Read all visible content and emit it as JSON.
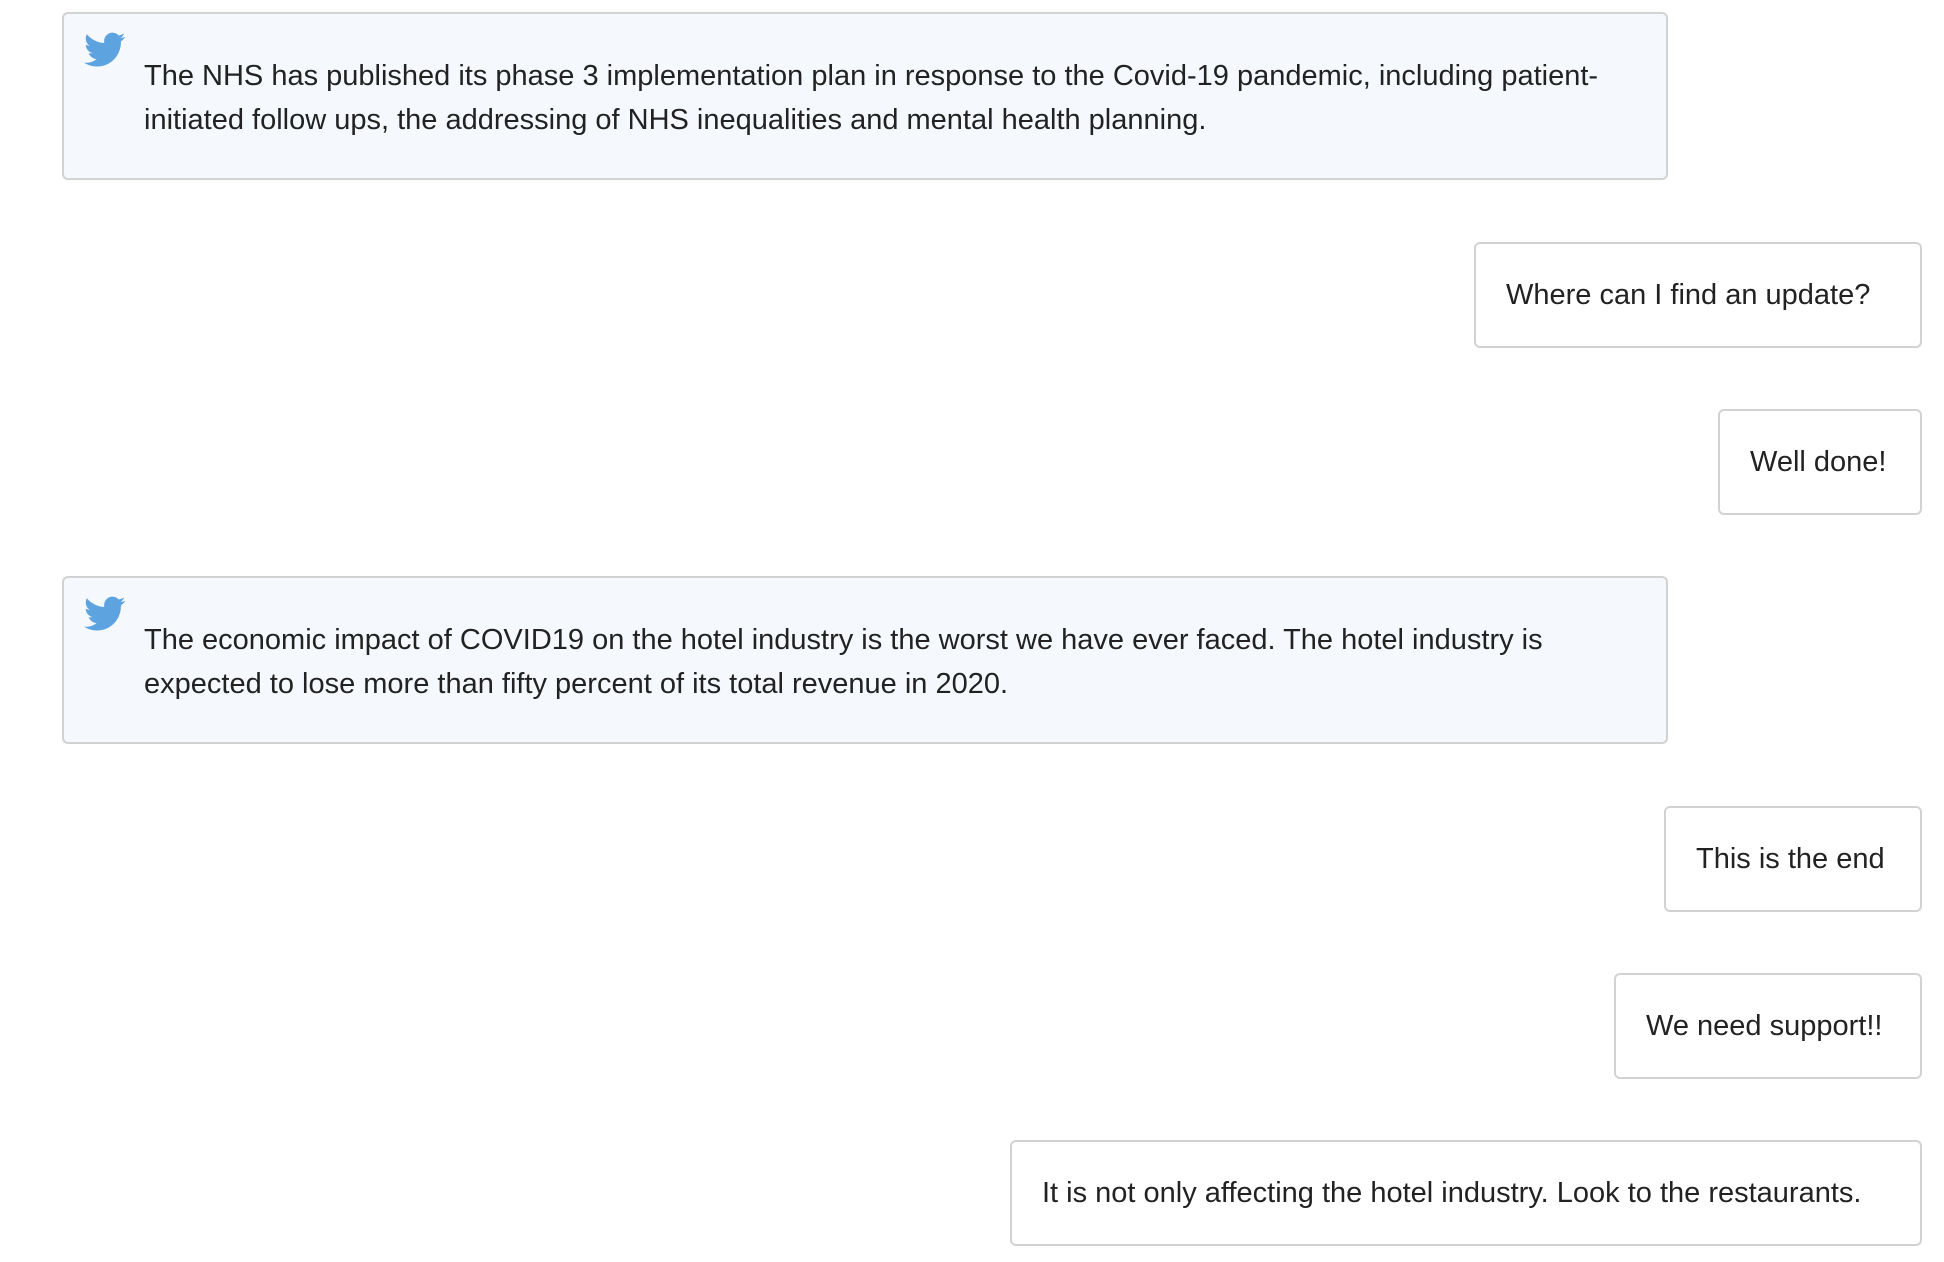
{
  "accent_color": "#5da3e0",
  "tweets": [
    {
      "icon": "twitter-bird-icon",
      "text": "The NHS has published its phase 3 implementation plan in response to the Covid-19 pandemic, including patient-initiated follow ups, the addressing of NHS inequalities and mental health planning."
    },
    {
      "icon": "twitter-bird-icon",
      "text": "The economic impact of COVID19 on the hotel industry is the worst we have ever faced. The hotel industry is expected to lose more than fifty percent of its total revenue in 2020."
    }
  ],
  "replies": [
    {
      "text": "Where can I find an update?"
    },
    {
      "text": "Well done!"
    },
    {
      "text": "This is the end"
    },
    {
      "text": "We need support!!"
    },
    {
      "text": "It is not only affecting the hotel industry. Look to the restaurants."
    }
  ]
}
